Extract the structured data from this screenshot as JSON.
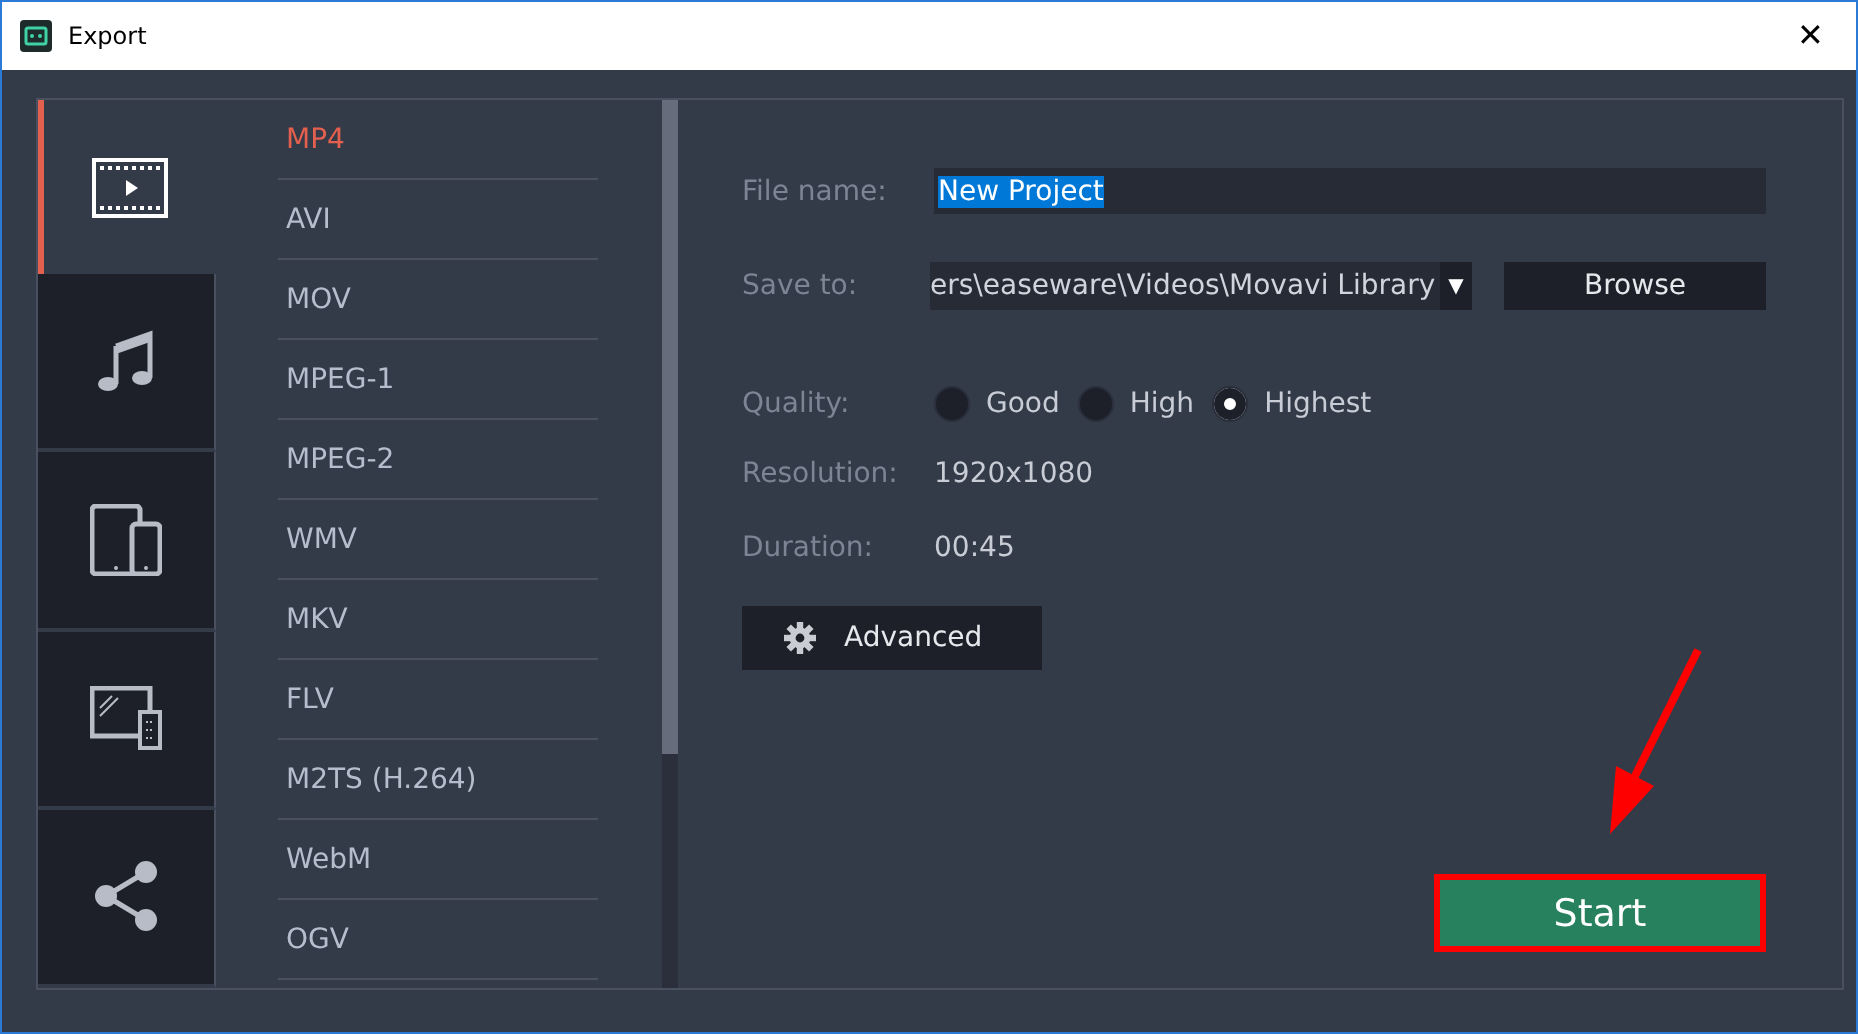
{
  "window": {
    "title": "Export",
    "close": "✕"
  },
  "categories": [
    {
      "kind": "video",
      "selected": true
    },
    {
      "kind": "audio",
      "selected": false
    },
    {
      "kind": "devices",
      "selected": false
    },
    {
      "kind": "tv",
      "selected": false
    },
    {
      "kind": "share",
      "selected": false
    }
  ],
  "formats": [
    {
      "label": "MP4",
      "selected": true
    },
    {
      "label": "AVI",
      "selected": false
    },
    {
      "label": "MOV",
      "selected": false
    },
    {
      "label": "MPEG-1",
      "selected": false
    },
    {
      "label": "MPEG-2",
      "selected": false
    },
    {
      "label": "WMV",
      "selected": false
    },
    {
      "label": "MKV",
      "selected": false
    },
    {
      "label": "FLV",
      "selected": false
    },
    {
      "label": "M2TS (H.264)",
      "selected": false
    },
    {
      "label": "WebM",
      "selected": false
    },
    {
      "label": "OGV",
      "selected": false
    }
  ],
  "file_name": {
    "label": "File name:",
    "value": "New Project",
    "text_selected": true
  },
  "save_to": {
    "label": "Save to:",
    "value": "ers\\easeware\\Videos\\Movavi Library",
    "caret": "▼",
    "browse": "Browse"
  },
  "quality": {
    "label": "Quality:",
    "options": [
      {
        "label": "Good",
        "selected": false
      },
      {
        "label": "High",
        "selected": false
      },
      {
        "label": "Highest",
        "selected": true
      }
    ]
  },
  "resolution": {
    "label": "Resolution:",
    "value": "1920x1080"
  },
  "duration": {
    "label": "Duration:",
    "value": "00:45"
  },
  "advanced_button": "Advanced",
  "start_button": {
    "label": "Start",
    "highlighted": true
  }
}
